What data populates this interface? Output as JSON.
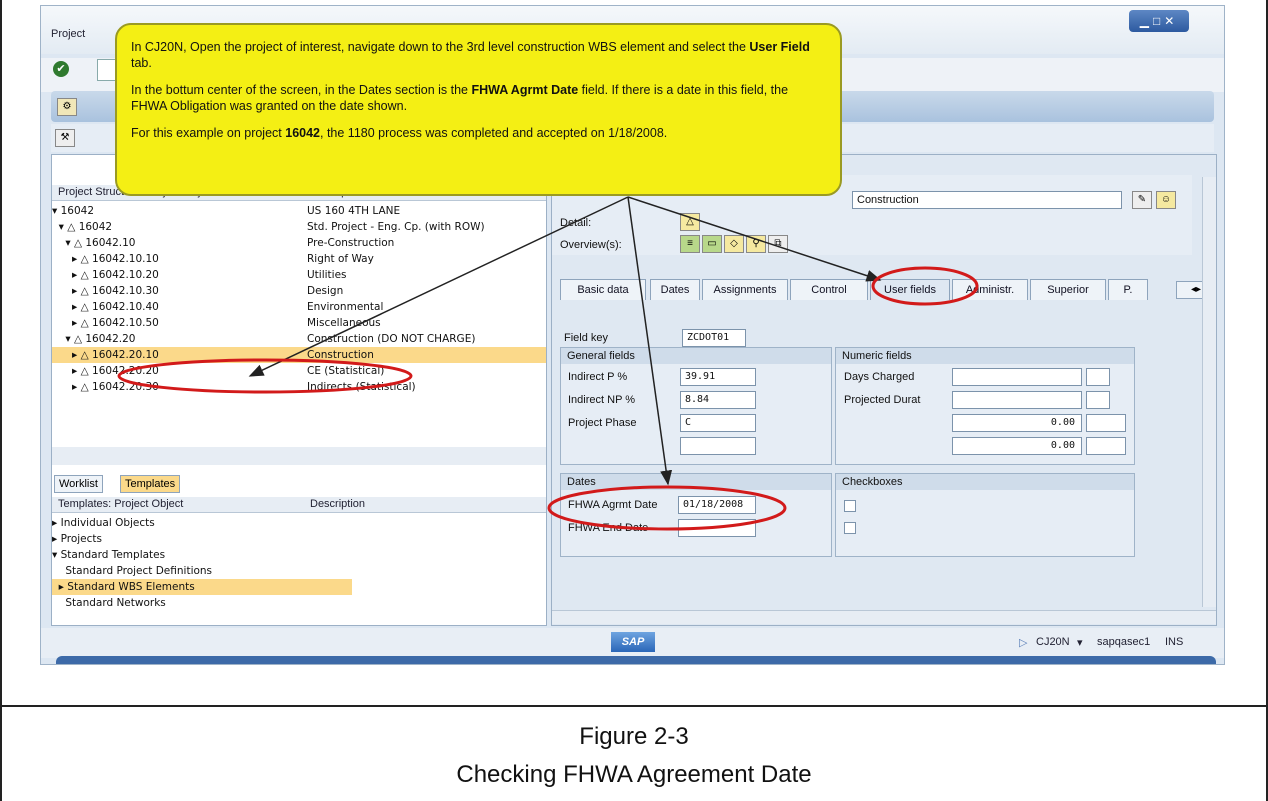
{
  "window": {
    "menu_label": "Project",
    "window_buttons": "▁□✕"
  },
  "callout": {
    "line1_pre": "In CJ20N, Open the project of interest, navigate down to the 3rd level construction WBS element and select the ",
    "line1_bold": "User Field",
    "line1_post": " tab.",
    "line2_pre": "In the bottum center of the screen, in the Dates section is the ",
    "line2_bold": "FHWA Agrmt Date",
    "line2_post": " field. If there is a date in this field, the FHWA Obligation was granted on the date shown.",
    "line3_pre": "For this example on project ",
    "line3_bold": "16042",
    "line3_post": ", the 1180 process was completed and accepted on 1/18/2008."
  },
  "left_tree": {
    "headers": [
      "Project Structure: Project Object",
      "Description"
    ],
    "rows": [
      {
        "obj": "▾ 16042",
        "desc": "US 160 4TH LANE"
      },
      {
        "obj": "  ▾ △ 16042",
        "desc": "Std. Project - Eng. Cp. (with ROW)"
      },
      {
        "obj": "    ▾ △ 16042.10",
        "desc": "Pre-Construction"
      },
      {
        "obj": "      ▸ △ 16042.10.10",
        "desc": "Right of Way"
      },
      {
        "obj": "      ▸ △ 16042.10.20",
        "desc": "Utilities"
      },
      {
        "obj": "      ▸ △ 16042.10.30",
        "desc": "Design"
      },
      {
        "obj": "      ▸ △ 16042.10.40",
        "desc": "Environmental"
      },
      {
        "obj": "      ▸ △ 16042.10.50",
        "desc": "Miscellaneous"
      },
      {
        "obj": "    ▾ △ 16042.20",
        "desc": "Construction (DO NOT CHARGE)"
      },
      {
        "obj": "      ▸ △ 16042.20.10",
        "desc": "Construction"
      },
      {
        "obj": "      ▸ △ 16042.20.20",
        "desc": "CE (Statistical)"
      },
      {
        "obj": "      ▸ △ 16042.20.30",
        "desc": "Indirects (Statistical)"
      }
    ],
    "worklist_tab": "Worklist",
    "templates_tab": "Templates",
    "template_headers": [
      "Templates: Project Object",
      "Description"
    ],
    "template_rows": [
      "▸ Individual Objects",
      "▸ Projects",
      "▾ Standard Templates",
      "    Standard Project Definitions",
      "  ▸ Standard WBS Elements",
      "    Standard Networks"
    ]
  },
  "right_panel": {
    "wbs_desc_value": "Construction",
    "detail_label": "Detail:",
    "overview_label": "Overview(s):",
    "tabs": [
      "Basic data",
      "Dates",
      "Assignments",
      "Control",
      "User fields",
      "Administr.",
      "Superior",
      "P."
    ],
    "field_key_label": "Field key",
    "field_key_value": "ZCDOT01",
    "general_fields_header": "General fields",
    "numeric_fields_header": "Numeric fields",
    "indirect_p_label": "Indirect P %",
    "indirect_p_value": "39.91",
    "indirect_np_label": "Indirect NP %",
    "indirect_np_value": "8.84",
    "project_phase_label": "Project Phase",
    "project_phase_value": "C",
    "days_charged_label": "Days Charged",
    "projected_durat_label": "Projected Durat",
    "num1": "0.00",
    "num2": "0.00",
    "dates_header": "Dates",
    "checkboxes_header": "Checkboxes",
    "fhwa_agrmt_label": "FHWA Agrmt Date",
    "fhwa_agrmt_value": "01/18/2008",
    "fhwa_end_label": "FHWA End Date"
  },
  "status": {
    "sap_logo": "SAP",
    "transaction": "CJ20N",
    "server": "sapqasec1",
    "mode": "INS"
  },
  "figure": {
    "number": "Figure 2-3",
    "title": "Checking FHWA Agreement Date"
  }
}
